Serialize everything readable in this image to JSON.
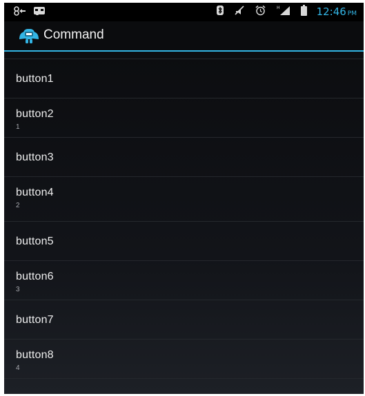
{
  "status_bar": {
    "time": "12:46",
    "ampm": "PM",
    "left_icons": [
      "usb-debug-icon",
      "voicemail-icon"
    ],
    "right_icons": [
      "bluetooth-icon",
      "mute-icon",
      "alarm-icon",
      "signal-icon",
      "battery-icon"
    ]
  },
  "action_bar": {
    "title": "Command",
    "icon": "android-robot-icon"
  },
  "list": {
    "items": [
      {
        "title": "button1",
        "summary": ""
      },
      {
        "title": "button2",
        "summary": "1"
      },
      {
        "title": "button3",
        "summary": ""
      },
      {
        "title": "button4",
        "summary": "2"
      },
      {
        "title": "button5",
        "summary": ""
      },
      {
        "title": "button6",
        "summary": "3"
      },
      {
        "title": "button7",
        "summary": ""
      },
      {
        "title": "button8",
        "summary": "4"
      }
    ]
  },
  "colors": {
    "accent": "#33b5e5",
    "background": "#0b0c0e",
    "text": "#f0f0f0",
    "summary_text": "#a8aab0",
    "divider": "#25282d"
  }
}
